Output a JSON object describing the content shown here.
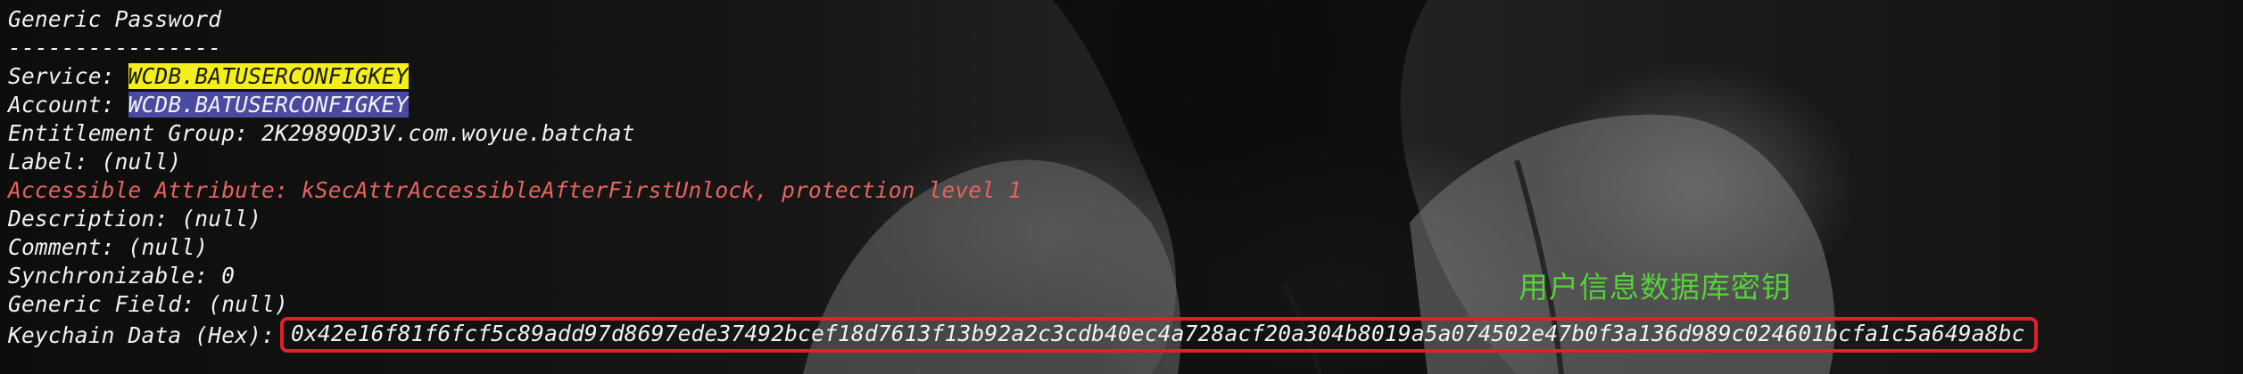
{
  "terminal": {
    "title": "Generic Password",
    "separator": "----------------",
    "service_label": "Service: ",
    "service_value": "WCDB.BATUSERCONFIGKEY",
    "account_label": "Account: ",
    "account_value": "WCDB.BATUSERCONFIGKEY",
    "entitlement_group": "Entitlement Group: 2K2989QD3V.com.woyue.batchat",
    "label": "Label: (null)",
    "accessible_attribute": "Accessible Attribute: kSecAttrAccessibleAfterFirstUnlock, protection level 1",
    "description": "Description: (null)",
    "comment": "Comment: (null)",
    "synchronizable": "Synchronizable: 0",
    "generic_field": "Generic Field: (null)",
    "keychain_data_label": "Keychain Data (Hex):",
    "keychain_data_value": "0x42e16f81f6fcf5c89add97d8697ede37492bcef18d7613f13b92a2c3cdb40ec4a728acf20a304b8019a5a074502e47b0f3a136d989c024601bcfa1c5a649a8bc"
  },
  "annotation": {
    "text": "用户信息数据库密钥",
    "color": "#56d13a"
  },
  "colors": {
    "service_highlight": "#f4ef1a",
    "account_highlight": "#4a4aa0",
    "warning_text": "#e8635c",
    "box_outline": "#e0202b"
  }
}
